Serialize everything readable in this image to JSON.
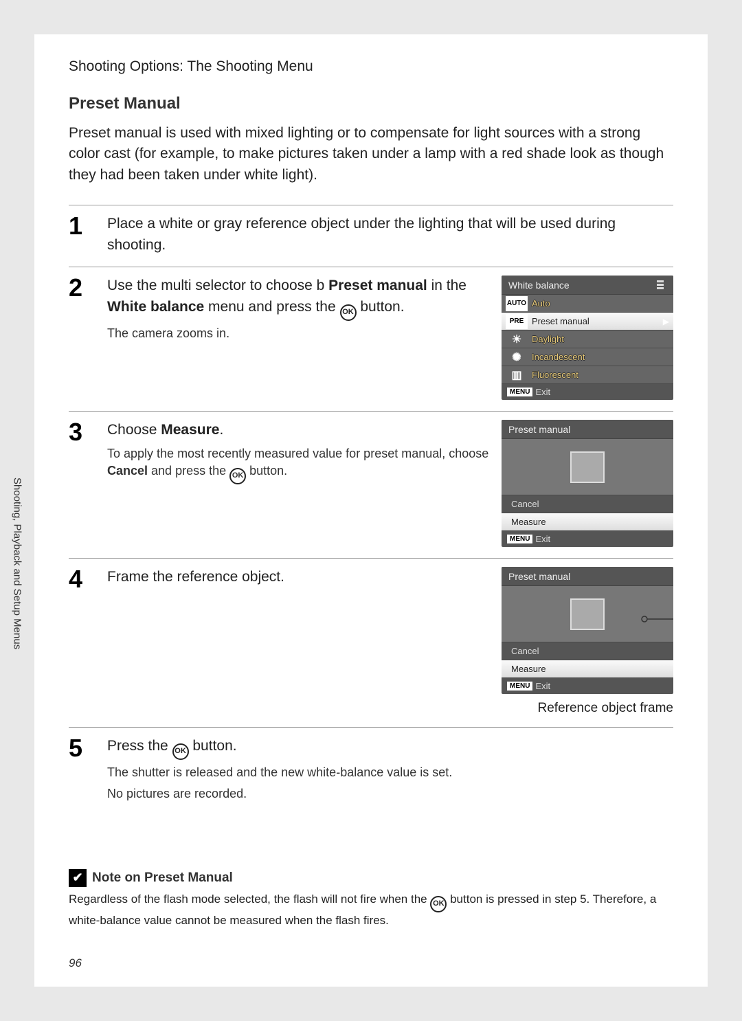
{
  "header": "Shooting Options: The Shooting Menu",
  "side_tab": "Shooting, Playback and Setup Menus",
  "section_title": "Preset Manual",
  "intro": "Preset manual is used with mixed lighting or to compensate for light sources with a strong color cast (for example, to make pictures taken under a lamp with a red shade look as though they had been taken under white light).",
  "steps": {
    "s1": {
      "num": "1",
      "text": "Place a white or gray reference object under the lighting that will be used during shooting."
    },
    "s2": {
      "num": "2",
      "text_a": "Use the multi selector to choose b  ",
      "text_b": "Preset manual",
      "text_c": " in the ",
      "text_d": "White balance",
      "text_e": " menu and press the ",
      "text_f": " button.",
      "sub": "The camera zooms in."
    },
    "s3": {
      "num": "3",
      "text_a": "Choose ",
      "text_b": "Measure",
      "text_c": ".",
      "sub_a": "To apply the most recently measured value for preset manual, choose ",
      "sub_b": "Cancel",
      "sub_c": " and press the ",
      "sub_d": " button."
    },
    "s4": {
      "num": "4",
      "text": "Frame the reference object."
    },
    "s5": {
      "num": "5",
      "text_a": "Press the ",
      "text_b": " button.",
      "sub_a": "The shutter is released and the new white-balance value is set.",
      "sub_b": "No pictures are recorded."
    }
  },
  "screen_wb": {
    "title": "White balance",
    "rows": [
      {
        "icon": "AUTO",
        "label": "Auto"
      },
      {
        "icon": "PRE",
        "label": "Preset manual",
        "hl": true
      },
      {
        "icon": "sun",
        "label": "Daylight"
      },
      {
        "icon": "sun",
        "label": "Incandescent"
      },
      {
        "icon": "fluo",
        "label": "Fluorescent"
      }
    ],
    "footer_menu": "MENU",
    "footer_exit": "Exit"
  },
  "screen_pm": {
    "title": "Preset manual",
    "cancel": "Cancel",
    "measure": "Measure",
    "footer_menu": "MENU",
    "footer_exit": "Exit"
  },
  "ref_label": "Reference object frame",
  "note": {
    "title": "Note on Preset Manual",
    "text_a": "Regardless of the flash mode selected, the flash will not fire when the ",
    "text_b": " button is pressed in step 5. Therefore, a white-balance value cannot be measured when the flash fires."
  },
  "page_number": "96",
  "ok_label": "OK"
}
